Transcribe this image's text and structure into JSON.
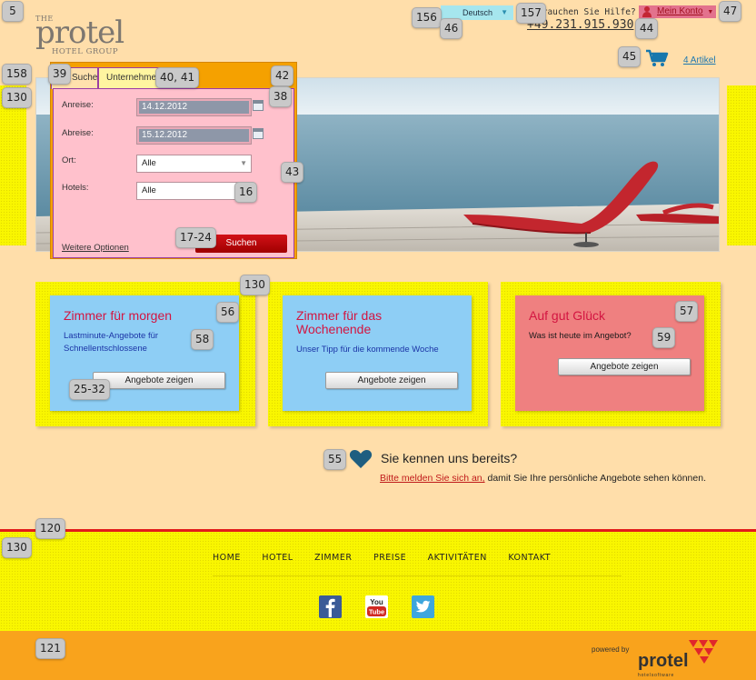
{
  "logo": {
    "the": "THE",
    "name": "protel",
    "sub": "HOTEL GROUP"
  },
  "header": {
    "language": "Deutsch",
    "help_question": "Brauchen Sie Hilfe?",
    "phone": "+49.231.915.930",
    "account": "Mein Konto",
    "cart": "4 Artikel"
  },
  "booking": {
    "tabs": [
      "Suche",
      "Unternehmen"
    ],
    "fields": {
      "arrival_label": "Anreise:",
      "arrival_value": "14.12.2012",
      "departure_label": "Abreise:",
      "departure_value": "15.12.2012",
      "location_label": "Ort:",
      "location_value": "Alle",
      "hotels_label": "Hotels:",
      "hotels_value": "Alle"
    },
    "more_options": "Weitere Optionen",
    "search_button": "Suchen"
  },
  "promos": [
    {
      "title": "Zimmer für morgen",
      "subtitle": "Lastminute-Angebote für Schnellentschlossene",
      "button": "Angebote zeigen",
      "color": "#8ecef5"
    },
    {
      "title": "Zimmer für das Wochenende",
      "subtitle": "Unser Tipp für die kommende Woche",
      "button": "Angebote zeigen",
      "color": "#8ecef5"
    },
    {
      "title": "Auf gut Glück",
      "subtitle": "Was ist heute im Angebot?",
      "button": "Angebote zeigen",
      "color": "#ef8080"
    }
  ],
  "known": {
    "title": "Sie kennen uns bereits?",
    "login_link": "Bitte melden Sie sich an,",
    "login_rest": " damit Sie Ihre persönliche Angebote sehen können."
  },
  "footer": {
    "nav": [
      "HOME",
      "HOTEL",
      "ZIMMER",
      "PREISE",
      "AKTIVITÄTEN",
      "KONTAKT"
    ],
    "social": [
      "facebook-icon",
      "youtube-icon",
      "twitter-icon"
    ],
    "youtube_text": [
      "You",
      "Tube"
    ],
    "powered": "powered by",
    "brand": "protel",
    "brand_tag": "hotelsoftware"
  },
  "overlay_badges": [
    "5",
    "156",
    "46",
    "157",
    "44",
    "47",
    "158",
    "39",
    "40, 41",
    "42",
    "130",
    "38",
    "43",
    "16",
    "17-24",
    "130",
    "56",
    "58",
    "25-32",
    "57",
    "59",
    "55",
    "120",
    "130",
    "121",
    "45"
  ],
  "colors": {
    "page_bg": "#ffdeaa",
    "accent_red": "#d31541",
    "footer_border": "#e31a1a",
    "bottom_bar": "#f9a31c",
    "booking_frame": "#f5a100"
  }
}
